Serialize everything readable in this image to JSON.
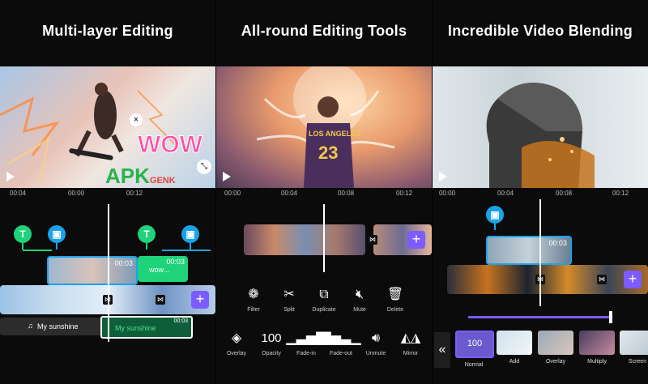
{
  "panels": [
    {
      "title": "Multi-layer Editing",
      "ruler": [
        "00:04",
        "00:00",
        "00:12"
      ],
      "sticker_text": "WOW",
      "watermark": "APK",
      "watermark_sub": "GENK",
      "clip_time_1": "00:03",
      "clip_time_2": "00:03",
      "text_clip": "wow...",
      "audio_1": "My sunshine",
      "audio_2": "My sunshine",
      "audio_time": "00:03"
    },
    {
      "title": "All-round Editing Tools",
      "ruler": [
        "00:00",
        "00:04",
        "00:08",
        "00:12"
      ],
      "jersey_text": "LOS ANGELES",
      "jersey_number": "23",
      "tools_row1": [
        "Filter",
        "Split",
        "Duplicate",
        "Mute",
        "Delete"
      ],
      "tools_row2": [
        "Overlay",
        "Opacity",
        "Fade-in",
        "Fade-out",
        "Unmute",
        "Mirror"
      ],
      "opacity_value": "100"
    },
    {
      "title": "Incredible Video Blending",
      "ruler": [
        "00:00",
        "00:04",
        "00:08",
        "00:12"
      ],
      "clip_time": "00:03",
      "blend_modes": [
        "Normal",
        "Add",
        "Overlay",
        "Multiply",
        "Screen"
      ],
      "blend_value": "100"
    }
  ],
  "colors": {
    "accent_purple": "#7c5cff",
    "text_green": "#1fd37a",
    "sticker_blue": "#1aa3e8"
  }
}
